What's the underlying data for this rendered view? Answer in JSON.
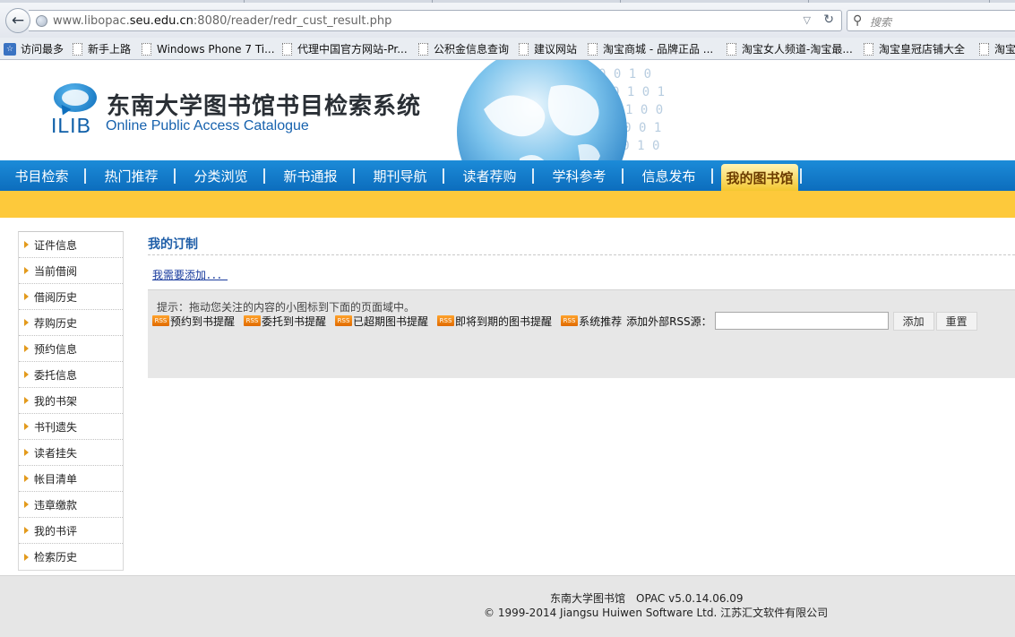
{
  "browser": {
    "url_host_prefix": "www.libopac.",
    "url_host_domain": "seu.edu.cn",
    "url_rest": ":8080/reader/redr_cust_result.php",
    "search_placeholder": "搜索",
    "bookmarks": [
      "访问最多",
      "新手上路",
      "Windows Phone 7 Ti...",
      "代理中国官方网站-Pr...",
      "公积金信息查询",
      "建议网站",
      "淘宝商城 - 品牌正品 ...",
      "淘宝女人频道-淘宝最...",
      "淘宝皇冠店铺大全",
      "淘宝"
    ]
  },
  "header": {
    "logo_text": "ILIB",
    "title": "东南大学图书馆书目检索系统",
    "subtitle": "Online Public Access Catalogue"
  },
  "nav": {
    "items": [
      "书目检索",
      "热门推荐",
      "分类浏览",
      "新书通报",
      "期刊导航",
      "读者荐购",
      "学科参考",
      "信息发布",
      "我的图书馆"
    ],
    "active_index": 8
  },
  "sidebar": {
    "items": [
      "证件信息",
      "当前借阅",
      "借阅历史",
      "荐购历史",
      "预约信息",
      "委托信息",
      "我的书架",
      "书刊遗失",
      "读者挂失",
      "帐目清单",
      "违章缴款",
      "我的书评",
      "检索历史"
    ]
  },
  "main": {
    "title": "我的订制",
    "add_link": "我需要添加．．．",
    "hint": "提示：拖动您关注的内容的小图标到下面的页面域中。",
    "rss_badge": "RSS",
    "feeds": [
      "预约到书提醒",
      "委托到书提醒",
      "已超期图书提醒",
      "即将到期的图书提醒",
      "系统推荐"
    ],
    "external_label": "添加外部RSS源：",
    "external_value": "",
    "add_button": "添加",
    "reset_button": "重置"
  },
  "footer": {
    "line1": "东南大学图书馆　OPAC v5.0.14.06.09",
    "line2": "© 1999-2014 Jiangsu Huiwen Software Ltd. 江苏汇文软件有限公司"
  },
  "colors": {
    "nav_blue": "#0c6dbd",
    "band_yellow": "#fdc93b",
    "title_blue": "#1f5ea8",
    "rss_orange": "#ff8a1a"
  }
}
